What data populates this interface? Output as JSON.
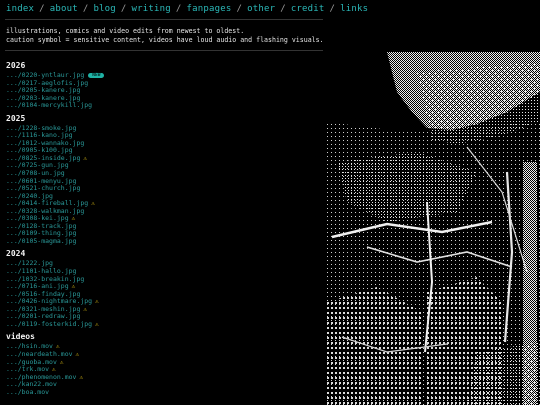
{
  "nav": {
    "items": [
      "index",
      "about",
      "blog",
      "writing",
      "fanpages",
      "other",
      "credit",
      "links"
    ],
    "separator": "/"
  },
  "intro": {
    "line1": "illustrations, comics and video edits from newest to oldest.",
    "line2": "caution symbol = sensitive content, videos have loud audio and flashing visuals."
  },
  "badge_new": "NEW",
  "warn_symbol": "⚠",
  "sections": [
    {
      "title": "2026",
      "files": [
        {
          "name": ".../0220-yntlaur.jpg",
          "new": true
        },
        {
          "name": ".../0217-aeglofis.jpg"
        },
        {
          "name": ".../0205-kanere.jpg"
        },
        {
          "name": ".../0203-kanere.jpg"
        },
        {
          "name": ".../0104-mercykill.jpg"
        }
      ]
    },
    {
      "title": "2025",
      "files": [
        {
          "name": ".../1228-smoke.jpg"
        },
        {
          "name": ".../1116-kano.jpg"
        },
        {
          "name": ".../1012-wannako.jpg"
        },
        {
          "name": ".../0905-k100.jpg"
        },
        {
          "name": ".../0825-inside.jpg",
          "warn": true
        },
        {
          "name": ".../0725-gun.jpg"
        },
        {
          "name": ".../0708-un.jpg"
        },
        {
          "name": ".../0601-menyu.jpg"
        },
        {
          "name": ".../0521-church.jpg"
        },
        {
          "name": ".../0240.jpg"
        },
        {
          "name": ".../0414-fireball.jpg",
          "warn": true
        },
        {
          "name": ".../0328-walkman.jpg"
        },
        {
          "name": ".../0308-kei.jpg",
          "warn": true
        },
        {
          "name": ".../0128-track.jpg"
        },
        {
          "name": ".../0109-thing.jpg"
        },
        {
          "name": ".../0105-magma.jpg"
        }
      ]
    },
    {
      "title": "2024",
      "files": [
        {
          "name": ".../1222.jpg"
        },
        {
          "name": ".../1101-hallo.jpg"
        },
        {
          "name": ".../1032-breakin.jpg"
        },
        {
          "name": ".../0716-ani.jpg",
          "warn": true
        },
        {
          "name": ".../0516-finday.jpg"
        },
        {
          "name": ".../0426-nightmare.jpg",
          "warn": true
        },
        {
          "name": ".../0321-meshin.jpg",
          "warn": true
        },
        {
          "name": ".../0201-redraw.jpg"
        },
        {
          "name": ".../0119-fosterkid.jpg",
          "warn": true
        }
      ]
    },
    {
      "title": "videos",
      "files": [
        {
          "name": ".../hsin.mov",
          "warn": true
        },
        {
          "name": ".../neardeath.mov",
          "warn": true
        },
        {
          "name": ".../guoba.mov",
          "warn": true
        },
        {
          "name": ".../trk.mov",
          "warn": true
        },
        {
          "name": ".../phenomenon.mov",
          "warn": true
        },
        {
          "name": ".../kan22.mov"
        },
        {
          "name": ".../boa.mov"
        }
      ]
    }
  ]
}
